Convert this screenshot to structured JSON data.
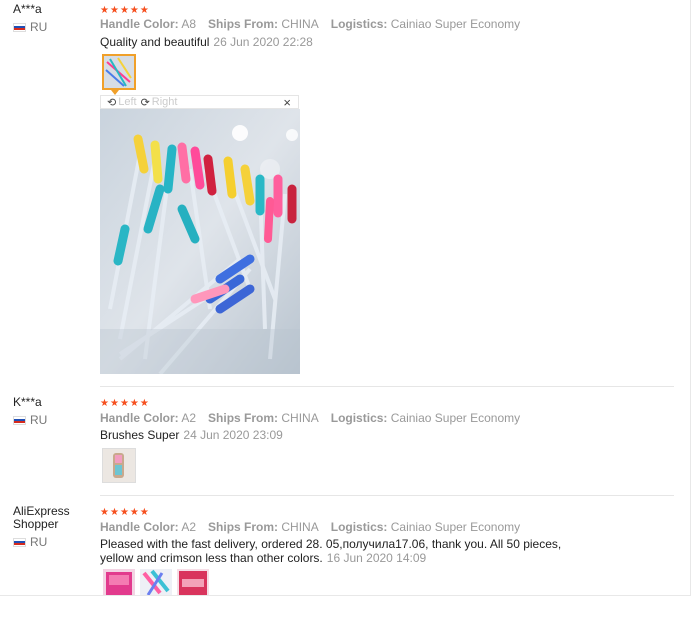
{
  "reviews": [
    {
      "user": "A***a",
      "country": "RU",
      "rating": 5,
      "labels": {
        "color": "Handle Color:",
        "ships": "Ships From:",
        "logistics": "Logistics:"
      },
      "color": "A8",
      "ships_from": "CHINA",
      "logistics": "Cainiao Super Economy",
      "text": "Quality and beautiful",
      "date": "26 Jun 2020 22:28"
    },
    {
      "user": "K***a",
      "country": "RU",
      "rating": 5,
      "labels": {
        "color": "Handle Color:",
        "ships": "Ships From:",
        "logistics": "Logistics:"
      },
      "color": "A2",
      "ships_from": "CHINA",
      "logistics": "Cainiao Super Economy",
      "text": "Brushes Super",
      "date": "24 Jun 2020 23:09"
    },
    {
      "user": "AliExpress Shopper",
      "country": "RU",
      "rating": 5,
      "labels": {
        "color": "Handle Color:",
        "ships": "Ships From:",
        "logistics": "Logistics:"
      },
      "color": "A2",
      "ships_from": "CHINA",
      "logistics": "Cainiao Super Economy",
      "text_line1": "Pleased with the fast delivery, ordered 28. 05,получила17.06, thank you. All 50 pieces,",
      "text_line2": "yellow and crimson less than other colors.",
      "date": "16 Jun 2020 14:09"
    }
  ],
  "viewer": {
    "rotate_left": "Left",
    "rotate_right": "Right",
    "close": "×",
    "rotate_left_icon": "rotate-left-icon",
    "rotate_right_icon": "rotate-right-icon"
  },
  "colors": {
    "star": "#f6501f",
    "active_thumb_border": "#f0a02a"
  }
}
